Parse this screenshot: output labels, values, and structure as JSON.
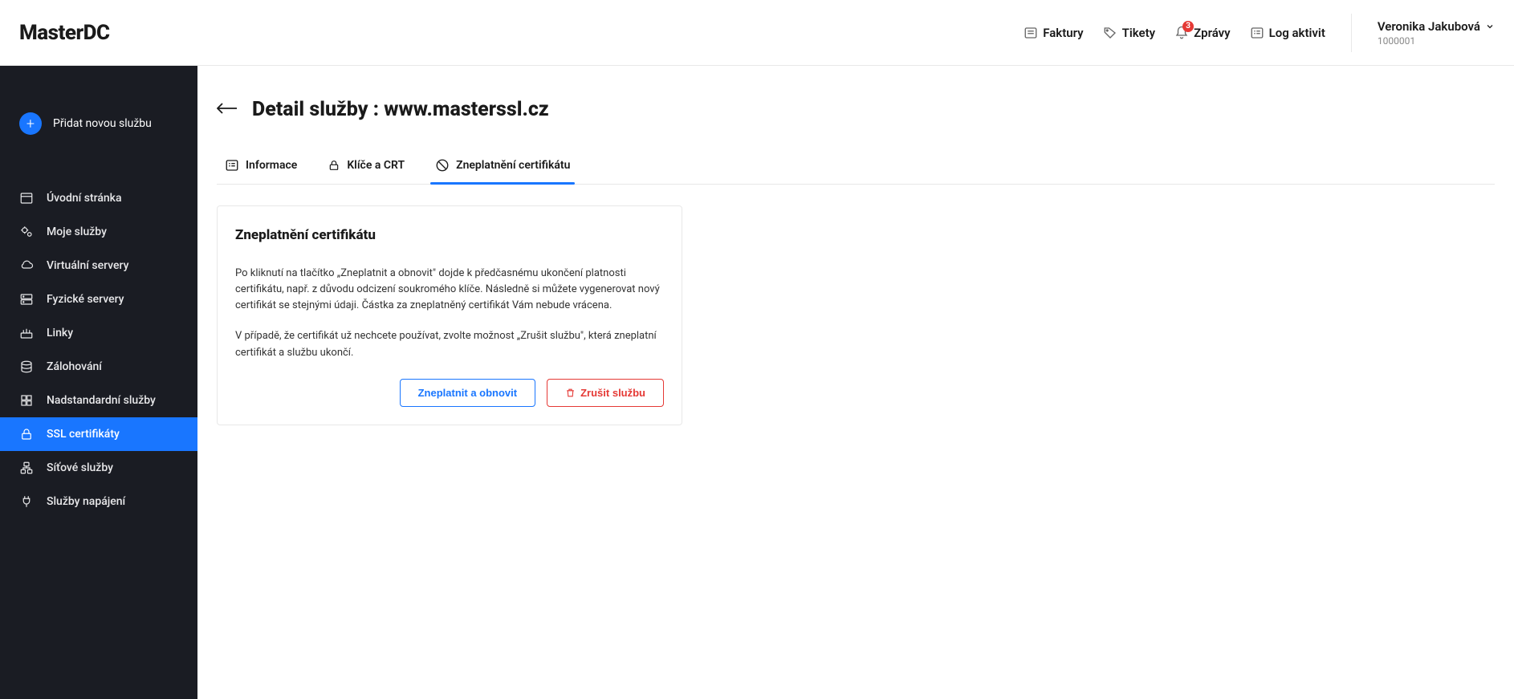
{
  "brand": "MasterDC",
  "header": {
    "links": {
      "invoices": "Faktury",
      "tickets": "Tikety",
      "messages": "Zprávy",
      "activity_log": "Log aktivit"
    },
    "messages_badge": "3",
    "user_name": "Veronika Jakubová",
    "user_id": "1000001"
  },
  "sidebar": {
    "add_service": "Přidat novou službu",
    "items": [
      "Úvodní stránka",
      "Moje služby",
      "Virtuální servery",
      "Fyzické servery",
      "Linky",
      "Zálohování",
      "Nadstandardní služby",
      "SSL certifikáty",
      "Síťové služby",
      "Služby napájení"
    ]
  },
  "page": {
    "title": "Detail služby : www.masterssl.cz"
  },
  "tabs": [
    "Informace",
    "Klíče a CRT",
    "Zneplatnění certifikátu"
  ],
  "card": {
    "title": "Zneplatnění certifikátu",
    "paragraph1": "Po kliknutí na tlačítko „Zneplatnit a obnovit\" dojde k předčasnému ukončení platnosti certifikátu, např. z důvodu odcizení soukromého klíče. Následně si můžete vygenerovat nový certifikát se stejnými údaji. Částka za zneplatněný certifikát Vám nebude vrácena.",
    "paragraph2": "V případě, že certifikát už nechcete používat, zvolte možnost „Zrušit službu\", která zneplatní certifikát a službu ukončí.",
    "btn_renew": "Zneplatnit a obnovit",
    "btn_cancel": "Zrušit službu"
  }
}
